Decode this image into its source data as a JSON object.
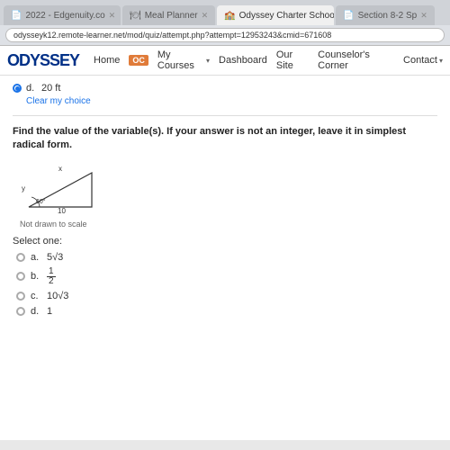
{
  "browser": {
    "tabs": [
      {
        "id": "tab1",
        "label": "2022 - Edgenuity.co",
        "active": false,
        "icon": "📄"
      },
      {
        "id": "tab2",
        "label": "Meal Planner",
        "active": false,
        "icon": "🍽"
      },
      {
        "id": "tab3",
        "label": "Odyssey Charter Schools of Nev",
        "active": true,
        "icon": "🏫"
      },
      {
        "id": "tab4",
        "label": "Section 8-2 Sp",
        "active": false,
        "icon": "📄"
      }
    ],
    "address": "odysseyk12.remote-learner.net/mod/quiz/attempt.php?attempt=12953243&cmid=671608"
  },
  "navbar": {
    "logo": "ODYSSEY",
    "oc_badge": "OC",
    "links": [
      {
        "label": "Home",
        "has_dropdown": false
      },
      {
        "label": "My Courses",
        "has_dropdown": true
      },
      {
        "label": "Dashboard",
        "has_dropdown": false
      },
      {
        "label": "Our Site",
        "has_dropdown": false
      },
      {
        "label": "Counselor's Corner",
        "has_dropdown": false
      },
      {
        "label": "Contact",
        "has_dropdown": true
      }
    ]
  },
  "content": {
    "previous_answer": {
      "label": "d.",
      "value": "20 ft",
      "selected": true
    },
    "clear_choice": "Clear my choice",
    "question": "Find the value of the variable(s). If your answer is not an integer, leave it in simplest radical form.",
    "triangle": {
      "sides": {
        "left": "y",
        "top": "x",
        "bottom": "10"
      },
      "angle": "60°",
      "not_to_scale": "Not drawn to scale"
    },
    "select_one": "Select one:",
    "options": [
      {
        "label": "a.",
        "value": "5√3"
      },
      {
        "label": "b.",
        "value": "1/2",
        "is_fraction": true,
        "num": "1",
        "den": "2"
      },
      {
        "label": "c.",
        "value": "10√3"
      },
      {
        "label": "d.",
        "value": "1"
      }
    ]
  }
}
